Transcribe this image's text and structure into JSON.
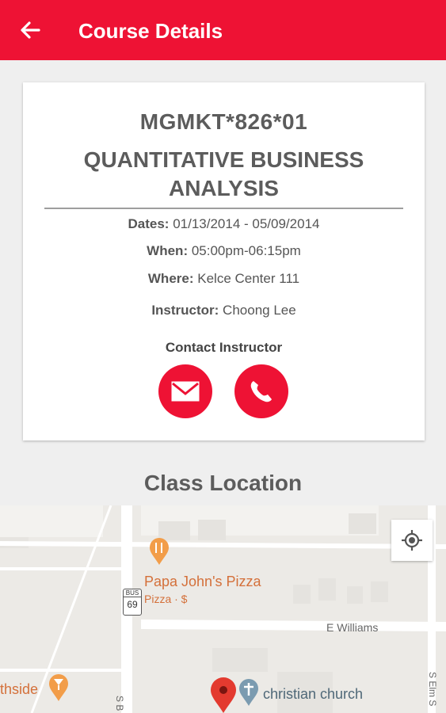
{
  "appbar": {
    "title": "Course Details",
    "back_icon": "arrow-left-icon"
  },
  "course": {
    "code": "MGMKT*826*01",
    "name": "QUANTITATIVE BUSINESS ANALYSIS",
    "dates_label": "Dates:",
    "dates_value": "01/13/2014 - 05/09/2014",
    "when_label": "When:",
    "when_value": "05:00pm-06:15pm",
    "where_label": "Where:",
    "where_value": "Kelce Center 111",
    "instructor_label": "Instructor:",
    "instructor_value": "Choong Lee",
    "contact_label": "Contact Instructor"
  },
  "section": {
    "title": "Class Location"
  },
  "map": {
    "poi_1": "Papa John's Pizza",
    "poi_1_sub": "Pizza · $",
    "street_1": "E Williams",
    "poi_2": "christian church",
    "poi_3": "thside",
    "route": "69",
    "route_top": "BUS",
    "street_2": "S B",
    "street_3": "S Elm S"
  },
  "colors": {
    "accent": "#ee1234",
    "text": "#5c5c5c",
    "poi": "#d4703a"
  }
}
